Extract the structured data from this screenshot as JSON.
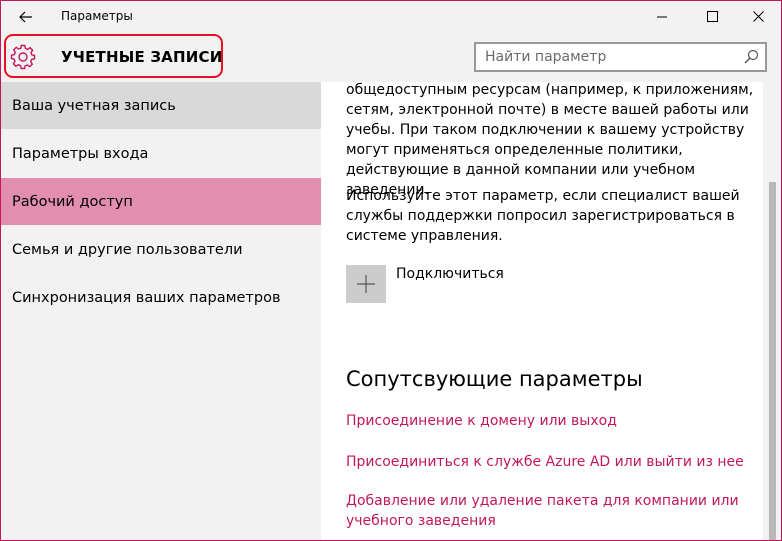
{
  "window": {
    "title": "Параметры"
  },
  "header": {
    "title": "УЧЕТНЫЕ ЗАПИСИ",
    "icon": "gear-icon"
  },
  "search": {
    "placeholder": "Найти параметр",
    "value": ""
  },
  "sidebar": {
    "items": [
      {
        "label": "Ваша учетная запись",
        "state": "hover"
      },
      {
        "label": "Параметры входа",
        "state": "normal"
      },
      {
        "label": "Рабочий доступ",
        "state": "active"
      },
      {
        "label": "Семья и другие пользователи",
        "state": "normal"
      },
      {
        "label": "Синхронизация ваших параметров",
        "state": "normal"
      }
    ]
  },
  "content": {
    "paragraph1": "общедоступным ресурсам (например, к приложениям, сетям, электронной почте) в месте вашей работы или учебы. При таком подключении к вашему устройству могут применяться определенные политики, действующие в данной компании или учебном заведении.",
    "paragraph2": "Используйте этот параметр, если специалист вашей службы поддержки попросил зарегистрироваться в системе управления.",
    "connect_label": "Подключиться",
    "related_heading": "Сопутсвующие параметры",
    "links": [
      "Присоединение к домену или выход",
      "Присоединиться к службе Azure AD или выйти из нее",
      "Добавление или удаление пакета для компании или учебного заведения"
    ]
  },
  "colors": {
    "accent": "#c2185b",
    "active_nav": "#e28eaf",
    "hover_nav": "#d9d9d9",
    "highlight_border": "#e81123",
    "background": "#f2f2f2"
  }
}
